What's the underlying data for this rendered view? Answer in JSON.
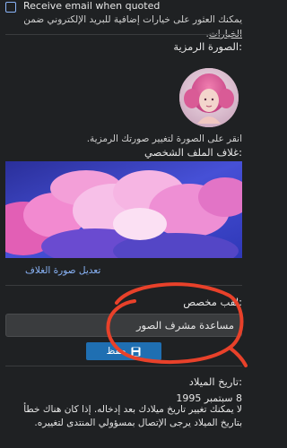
{
  "email": {
    "checkbox_label": "Receive email when quoted",
    "checked": false
  },
  "helper": {
    "text_prefix": "يمكنك العثور على خيارات إضافية للبريد الإلكتروني ضمن ",
    "link": "الخيارات"
  },
  "avatar": {
    "title": "الصورة الرمزية:",
    "hint": "انقر على الصورة لتغيير صورتك الرمزية."
  },
  "cover": {
    "title": "غلاف الملف الشخصي:",
    "edit_link": "تعديل صورة الغلاف"
  },
  "custom_title": {
    "label": "لقب مخصص:",
    "value": "مساعدة مشرف الصور"
  },
  "save": {
    "label": "حفظ"
  },
  "dob": {
    "label": "تاريخ الميلاد:",
    "value": "8 سبتمبر 1995",
    "note": "لا يمكنك تغيير تاريخ ميلادك بعد إدخاله. إذا كان هناك خطأ بتاريخ الميلاد يرجى الإتصال بمسؤولي المنتدى لتغييره."
  },
  "colors": {
    "background": "#1f2123",
    "accent": "#1f6fb2",
    "annotation": "#e8412a",
    "link": "#8ab4f8"
  }
}
